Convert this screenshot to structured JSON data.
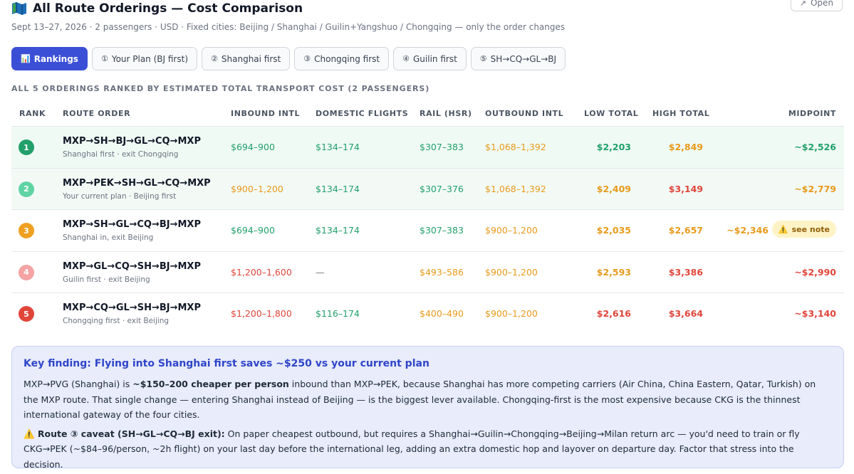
{
  "header": {
    "title": "All Route Orderings — Cost Comparison",
    "subtitle": "Sept 13–27, 2026 · 2 passengers · USD · Fixed cities: Beijing / Shanghai / Guilin+Yangshuo / Chongqing — only the order changes",
    "open_label": "Open"
  },
  "tabs": [
    {
      "icon": "📊",
      "label": "Rankings"
    },
    {
      "icon": "①",
      "label": "Your Plan (BJ first)"
    },
    {
      "icon": "②",
      "label": "Shanghai first"
    },
    {
      "icon": "③",
      "label": "Chongqing first"
    },
    {
      "icon": "④",
      "label": "Guilin first"
    },
    {
      "icon": "⑤",
      "label": "SH→CQ→GL→BJ"
    }
  ],
  "section_label": "ALL 5 ORDERINGS RANKED BY ESTIMATED TOTAL TRANSPORT COST (2 PASSENGERS)",
  "columns": {
    "rank": "RANK",
    "route": "ROUTE ORDER",
    "inbound": "INBOUND INTL",
    "domestic": "DOMESTIC FLIGHTS",
    "rail": "RAIL (HSR)",
    "outbound": "OUTBOUND INTL",
    "low": "LOW TOTAL",
    "high": "HIGH TOTAL",
    "mid": "MIDPOINT"
  },
  "rows": [
    {
      "rank": "1",
      "route": "MXP→SH→BJ→GL→CQ→MXP",
      "sub": "Shanghai first · exit Chongqing",
      "inbound": "$694–900",
      "domestic": "$134–174",
      "rail": "$307–383",
      "outbound": "$1,068–1,392",
      "low": "$2,203",
      "high": "$2,849",
      "mid": "~$2,526"
    },
    {
      "rank": "2",
      "route": "MXP→PEK→SH→GL→CQ→MXP",
      "sub": "Your current plan · Beijing first",
      "inbound": "$900–1,200",
      "domestic": "$134–174",
      "rail": "$307–376",
      "outbound": "$1,068–1,392",
      "low": "$2,409",
      "high": "$3,149",
      "mid": "~$2,779"
    },
    {
      "rank": "3",
      "route": "MXP→SH→GL→CQ→BJ→MXP",
      "sub": "Shanghai in, exit Beijing",
      "inbound": "$694–900",
      "domestic": "$134–174",
      "rail": "$307–383",
      "outbound": "$900–1,200",
      "low": "$2,035",
      "high": "$2,657",
      "mid": "~$2,346",
      "note": "see note"
    },
    {
      "rank": "4",
      "route": "MXP→GL→CQ→SH→BJ→MXP",
      "sub": "Guilin first · exit Beijing",
      "inbound": "$1,200–1,600",
      "domestic": "—",
      "rail": "$493–586",
      "outbound": "$900–1,200",
      "low": "$2,593",
      "high": "$3,386",
      "mid": "~$2,990"
    },
    {
      "rank": "5",
      "route": "MXP→CQ→GL→SH→BJ→MXP",
      "sub": "Chongqing first · exit Beijing",
      "inbound": "$1,200–1,800",
      "domestic": "$116–174",
      "rail": "$400–490",
      "outbound": "$900–1,200",
      "low": "$2,616",
      "high": "$3,664",
      "mid": "~$3,140"
    }
  ],
  "colors": {
    "green": "#22a06b",
    "teal": "#5fd3a3",
    "orange": "#f0a020",
    "pink": "#f5a3a3",
    "red": "#e0453a",
    "accent": "#3b4fd6"
  },
  "finding": {
    "title": "Key finding: Flying into Shanghai first saves ~$250 vs your current plan",
    "p1_a": "MXP→PVG (Shanghai) is ",
    "p1_b": "~$150–200 cheaper per person",
    "p1_c": " inbound than MXP→PEK, because Shanghai has more competing carriers (Air China, China Eastern, Qatar, Turkish) on the MXP route. That single change — entering Shanghai instead of Beijing — is the biggest lever available. Chongqing-first is the most expensive because CKG is the thinnest international gateway of the four cities.",
    "p2_icon": "⚠️",
    "p2_b": " Route ③ caveat (SH→GL→CQ→BJ exit):",
    "p2_c": " On paper cheapest outbound, but requires a Shanghai→Guilin→Chongqing→Beijing→Milan return arc — you'd need to train or fly CKG→PEK (~$84–96/person, ~2h flight) on your last day before the international leg, adding an extra domestic hop and layover on departure day. Factor that stress into the decision."
  }
}
